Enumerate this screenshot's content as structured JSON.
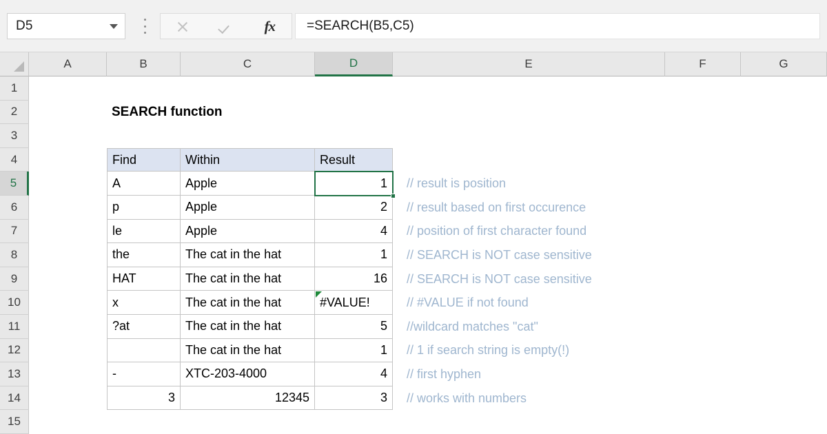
{
  "formula_bar": {
    "name_box_value": "D5",
    "formula": "=SEARCH(B5,C5)",
    "cancel_icon": "close-icon",
    "confirm_icon": "check-icon",
    "function_icon": "fx-icon",
    "dropdown_icon": "chevron-down-icon",
    "kebab_icon": "more-options-icon"
  },
  "grid": {
    "columns": [
      "A",
      "B",
      "C",
      "D",
      "E",
      "F",
      "G"
    ],
    "rows": [
      "1",
      "2",
      "3",
      "4",
      "5",
      "6",
      "7",
      "8",
      "9",
      "10",
      "11",
      "12",
      "13",
      "14",
      "15"
    ],
    "selected_column": "D",
    "selected_row": "5",
    "selected_cell": "D5"
  },
  "sheet": {
    "title": "SEARCH function",
    "table_headers": [
      "Find",
      "Within",
      "Result"
    ],
    "rows": [
      {
        "find": "A",
        "within": "Apple",
        "result": "1",
        "note": "// result is position"
      },
      {
        "find": "p",
        "within": "Apple",
        "result": "2",
        "note": "// result based on first occurence"
      },
      {
        "find": "le",
        "within": "Apple",
        "result": "4",
        "note": "// position of first character found"
      },
      {
        "find": "the",
        "within": "The cat in the hat",
        "result": "1",
        "note": "// SEARCH is NOT case sensitive"
      },
      {
        "find": "HAT",
        "within": "The cat in the hat",
        "result": "16",
        "note": "// SEARCH is NOT case sensitive"
      },
      {
        "find": "x",
        "within": "The cat in the hat",
        "result": "#VALUE!",
        "note": "// #VALUE if not found"
      },
      {
        "find": "?at",
        "within": "The cat in the hat",
        "result": "5",
        "note": "//wildcard matches \"cat\""
      },
      {
        "find": "",
        "within": "The cat in the hat",
        "result": "1",
        "note": "// 1 if search string is empty(!)"
      },
      {
        "find": "-",
        "within": "XTC-203-4000",
        "result": "4",
        "note": "// first hyphen"
      },
      {
        "find": "3",
        "within": "12345",
        "result": "3",
        "note": "// works with numbers"
      }
    ]
  },
  "colors": {
    "accent_green": "#217346",
    "header_fill": "#dce3f1",
    "note_text": "#9fb6cf",
    "error_marker": "#1f8a3b"
  }
}
